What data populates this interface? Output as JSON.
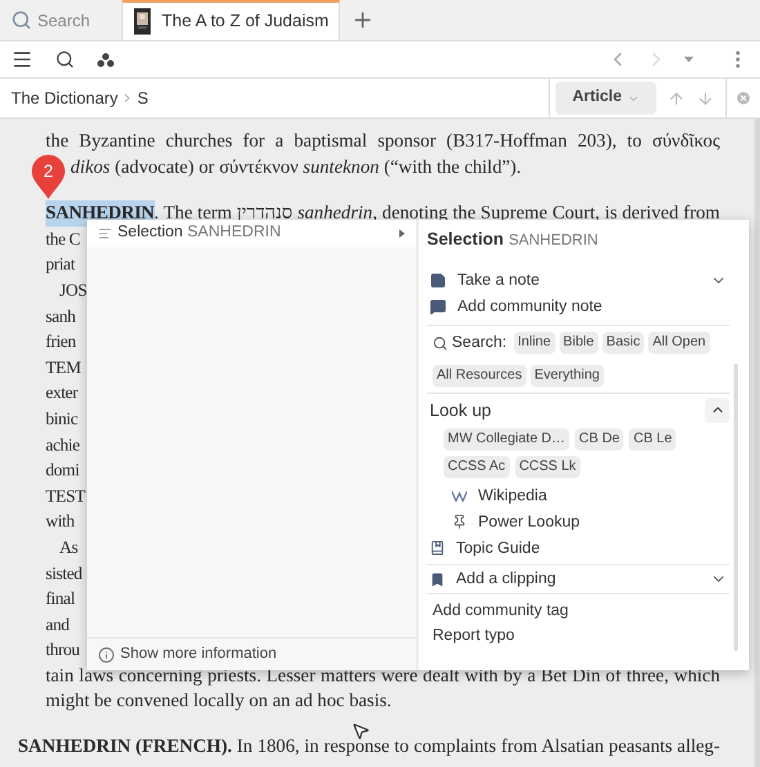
{
  "tabs": [
    {
      "kind": "search",
      "label": "Search",
      "selected": false
    },
    {
      "kind": "document",
      "label": "The A to Z of Judaism",
      "selected": true
    }
  ],
  "breadcrumb": [
    "The Dictionary",
    "S"
  ],
  "view_button": "Article",
  "document": {
    "marker": "2",
    "lines": [
      {
        "kind": "full",
        "text": "the Byzantine churches for a baptismal sponsor (B317-Hoffman 203), to σύνδῖκος"
      },
      {
        "kind": "covered",
        "text": "*dikos* (advocate) or σύντέκνον *sunteknon* (“with the child”)."
      },
      {
        "kind": "headword",
        "headword": "SANHEDRIN",
        "selected": true,
        "text": ". The term סנהדרין *sanhedrin*, denoting the Supreme Court, is derived from"
      },
      {
        "kind": "fragment",
        "indent": false,
        "text": "the C"
      },
      {
        "kind": "fragment",
        "indent": false,
        "text": "priat"
      },
      {
        "kind": "fragment",
        "indent": true,
        "text": "JOS"
      },
      {
        "kind": "fragment",
        "indent": false,
        "text": "sanh"
      },
      {
        "kind": "fragment",
        "indent": false,
        "text": "frien"
      },
      {
        "kind": "fragment",
        "indent": false,
        "text": "TEM"
      },
      {
        "kind": "fragment",
        "indent": false,
        "text": "exter"
      },
      {
        "kind": "fragment",
        "indent": false,
        "text": "binic"
      },
      {
        "kind": "fragment",
        "indent": false,
        "text": "achie"
      },
      {
        "kind": "fragment",
        "indent": false,
        "text": "domi"
      },
      {
        "kind": "fragment",
        "indent": false,
        "text": "TEST"
      },
      {
        "kind": "fragment",
        "indent": false,
        "text": "with"
      },
      {
        "kind": "fragment",
        "indent": true,
        "text": "As"
      },
      {
        "kind": "fragment",
        "indent": false,
        "text": "sisted"
      },
      {
        "kind": "fragment",
        "indent": false,
        "text": "final"
      },
      {
        "kind": "fragment",
        "indent": false,
        "text": "and"
      },
      {
        "kind": "fragment",
        "indent": false,
        "text": "throu"
      },
      {
        "kind": "full",
        "text": "tain laws concerning priests. Lesser matters were dealt with by a Bet Din of three, which"
      },
      {
        "kind": "last",
        "text": "might be convened locally on an ad hoc basis."
      },
      {
        "kind": "entry",
        "text": "**SANHEDRIN (FRENCH).** In 1806, in response to complaints from Alsatian peasants alleg-"
      }
    ]
  },
  "popup": {
    "menu_item": {
      "label": "Selection",
      "value": "SANHEDRIN"
    },
    "more_info": "Show more information",
    "panel": {
      "title": "Selection",
      "value": "SANHEDRIN",
      "actions": [
        {
          "kind": "note",
          "label": "Take a note",
          "expandable": true
        },
        {
          "kind": "comment",
          "label": "Add community note",
          "expandable": false
        }
      ],
      "search_label": "Search:",
      "search_chips": [
        "Inline",
        "Bible",
        "Basic",
        "All Open",
        "All Resources",
        "Everything"
      ],
      "lookup_title": "Look up",
      "lookup_expanded": true,
      "lookup_chips": [
        "MW Collegiate D…",
        "CB De",
        "CB Le",
        "CCSS Ac",
        "CCSS Lk"
      ],
      "lookup_links": [
        {
          "kind": "wiki",
          "label": "Wikipedia"
        },
        {
          "kind": "pin",
          "label": "Power Lookup"
        }
      ],
      "topic_guide": "Topic Guide",
      "clipping": "Add a clipping",
      "footer_links": [
        "Add community tag",
        "Report typo"
      ]
    }
  }
}
